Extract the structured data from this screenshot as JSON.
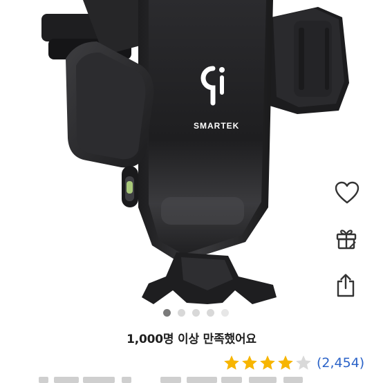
{
  "product_image": {
    "brand": "SMARTEK",
    "badge_icon": "qi-wireless-charging-logo"
  },
  "actions": {
    "wishlist_icon": "heart-outline-icon",
    "gift_icon": "gift-icon",
    "share_icon": "share-icon"
  },
  "carousel": {
    "total_slides": 5,
    "active_index": 0
  },
  "satisfaction": {
    "text": "1,000명 이상 만족했어요"
  },
  "rating": {
    "stars": 4,
    "max_stars": 5,
    "count_text": "(2,454)"
  },
  "colors": {
    "star_filled": "#f7b500",
    "star_empty": "#d9d9d9",
    "link_blue": "#2b63c8",
    "dot_active": "#7a7a7a",
    "dot_inactive": "#d8d8d8"
  }
}
